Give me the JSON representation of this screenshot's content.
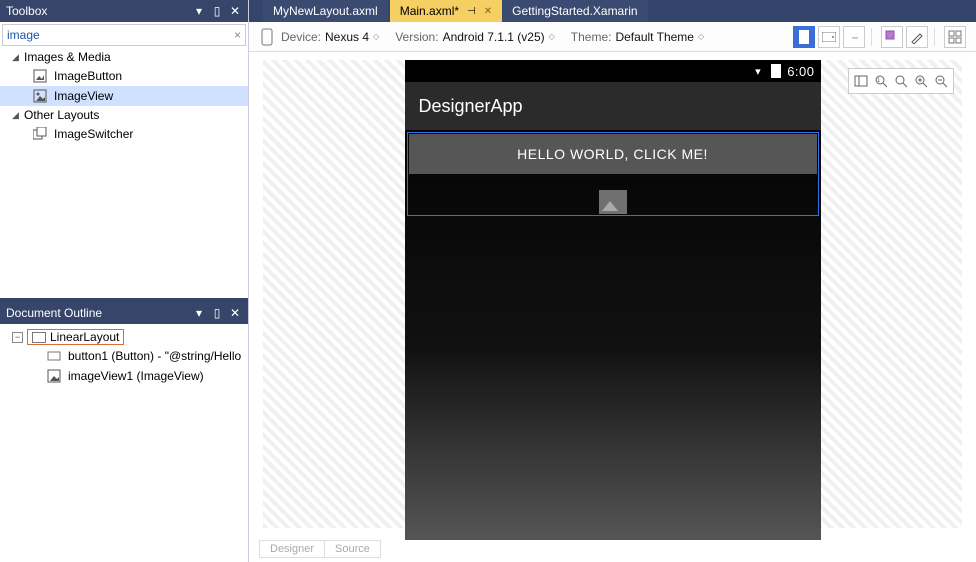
{
  "toolbox": {
    "title": "Toolbox",
    "search": "image",
    "groups": [
      {
        "label": "Images & Media",
        "items": [
          {
            "label": "ImageButton",
            "selected": false
          },
          {
            "label": "ImageView",
            "selected": true
          }
        ]
      },
      {
        "label": "Other Layouts",
        "items": [
          {
            "label": "ImageSwitcher",
            "selected": false
          }
        ]
      }
    ]
  },
  "outline": {
    "title": "Document Outline",
    "root": "LinearLayout",
    "children": [
      "button1 (Button) - \"@string/Hello",
      "imageView1 (ImageView)"
    ]
  },
  "tabs": {
    "left": "MyNewLayout.axml",
    "active": "Main.axml*",
    "right": "GettingStarted.Xamarin"
  },
  "toolbar": {
    "device_lbl": "Device:",
    "device": "Nexus 4",
    "version_lbl": "Version:",
    "version": "Android 7.1.1 (v25)",
    "theme_lbl": "Theme:",
    "theme": "Default Theme"
  },
  "phone": {
    "time": "6:00",
    "app_title": "DesignerApp",
    "button_text": "HELLO WORLD, CLICK ME!"
  },
  "bottom": {
    "designer": "Designer",
    "source": "Source"
  }
}
